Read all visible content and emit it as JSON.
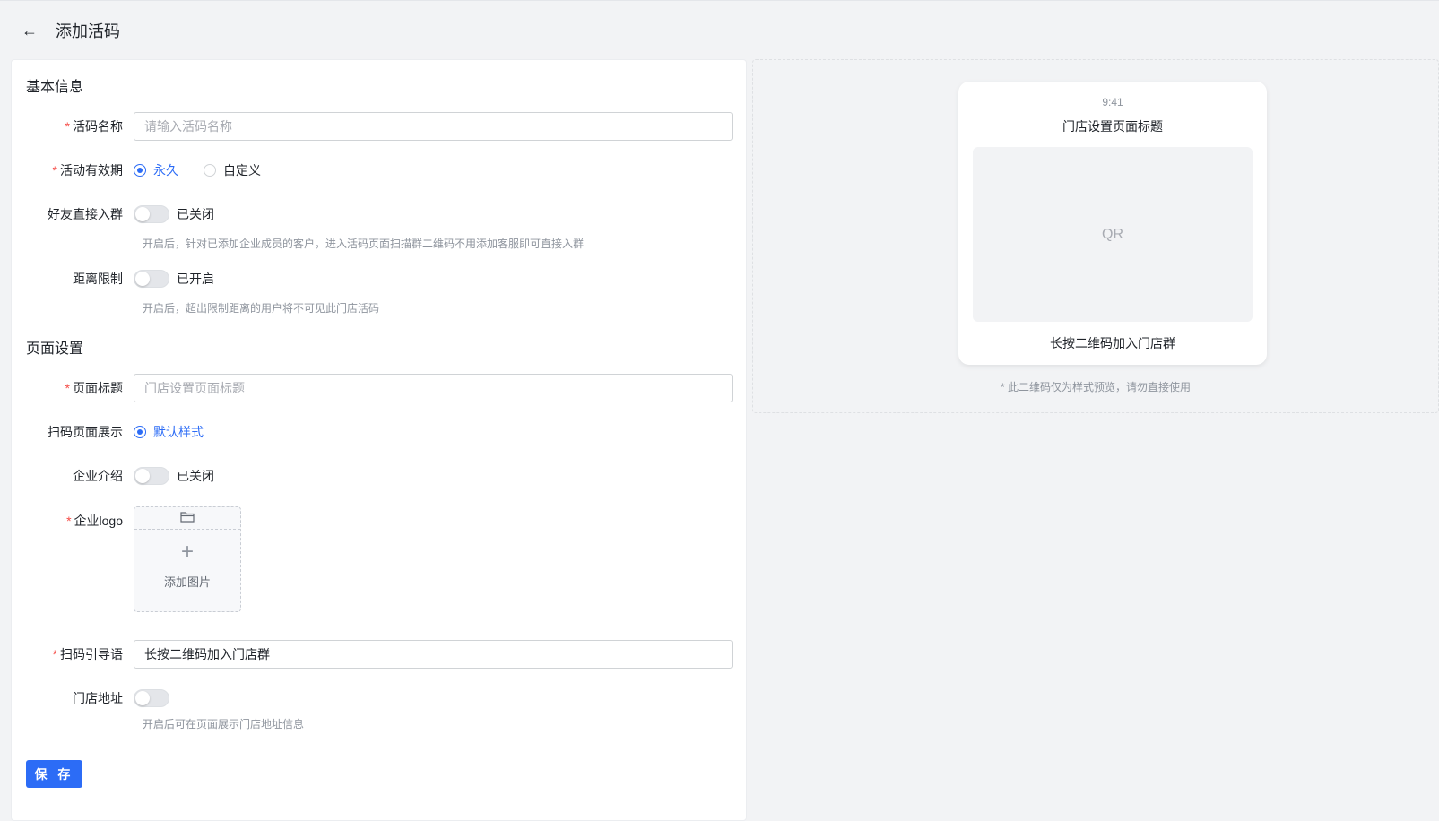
{
  "header": {
    "back_glyph": "←",
    "title": "添加活码"
  },
  "basic_section": {
    "title": "基本信息",
    "name_field": {
      "label": "活码名称",
      "required_mark": "*",
      "placeholder": "请输入活码名称",
      "value": ""
    },
    "validity": {
      "label": "活动有效期",
      "required_mark": "*",
      "options": [
        {
          "label": "永久",
          "checked": true
        },
        {
          "label": "自定义",
          "checked": false
        }
      ]
    },
    "friend_join": {
      "label": "好友直接入群",
      "state_text": "已关闭",
      "on": false,
      "hint": "开启后，针对已添加企业成员的客户，进入活码页面扫描群二维码不用添加客服即可直接入群"
    },
    "distance_limit": {
      "label": "距离限制",
      "state_text": "已开启",
      "on": false,
      "hint": "开启后，超出限制距离的用户将不可见此门店活码"
    }
  },
  "page_section": {
    "title": "页面设置",
    "page_title_field": {
      "label": "页面标题",
      "required_mark": "*",
      "placeholder": "门店设置页面标题",
      "value": ""
    },
    "scan_display": {
      "label": "扫码页面展示",
      "option": "默认样式",
      "checked": true
    },
    "company_intro": {
      "label": "企业介绍",
      "state_text": "已关闭",
      "on": false
    },
    "company_logo": {
      "label": "企业logo",
      "required_mark": "*",
      "folder_icon": "folder-icon",
      "plus_glyph": "+",
      "upload_text": "添加图片"
    },
    "scan_guide": {
      "label": "扫码引导语",
      "required_mark": "*",
      "value": "长按二维码加入门店群"
    },
    "store_address": {
      "label": "门店地址",
      "on": false,
      "hint": "开启后可在页面展示门店地址信息"
    }
  },
  "save_label": "保 存",
  "preview": {
    "time": "9:41",
    "title": "门店设置页面标题",
    "qr_text": "QR",
    "guide": "长按二维码加入门店群",
    "note": "* 此二维码仅为样式预览，请勿直接使用"
  },
  "colors": {
    "primary": "#2c6cf6",
    "required": "#f54a45",
    "hint": "#8f959e"
  }
}
